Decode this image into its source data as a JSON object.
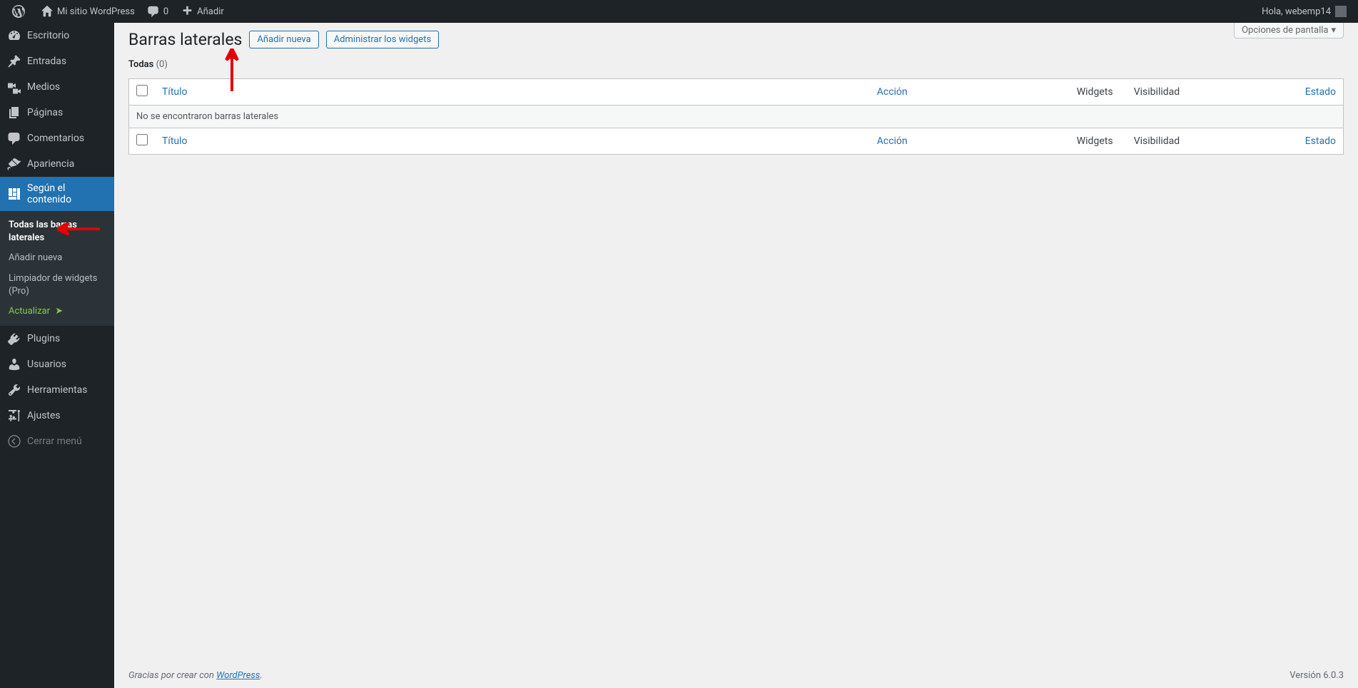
{
  "adminbar": {
    "site_name": "Mi sitio WordPress",
    "comments_count": "0",
    "add_label": "Añadir",
    "greeting": "Hola, webemp14"
  },
  "menu": {
    "items": [
      {
        "id": "dashboard",
        "label": "Escritorio",
        "icon": "dashboard"
      },
      {
        "id": "posts",
        "label": "Entradas",
        "icon": "pin"
      },
      {
        "id": "media",
        "label": "Medios",
        "icon": "media"
      },
      {
        "id": "pages",
        "label": "Páginas",
        "icon": "page"
      },
      {
        "id": "comments",
        "label": "Comentarios",
        "icon": "comment"
      },
      {
        "id": "appearance",
        "label": "Apariencia",
        "icon": "brush"
      },
      {
        "id": "contentaware",
        "label": "Según el contenido",
        "icon": "layout",
        "current": true
      },
      {
        "id": "plugins",
        "label": "Plugins",
        "icon": "plugin"
      },
      {
        "id": "users",
        "label": "Usuarios",
        "icon": "user"
      },
      {
        "id": "tools",
        "label": "Herramientas",
        "icon": "wrench"
      },
      {
        "id": "settings",
        "label": "Ajustes",
        "icon": "sliders"
      },
      {
        "id": "collapse",
        "label": "Cerrar menú",
        "icon": "collapse"
      }
    ],
    "submenu": [
      {
        "label": "Todas las barras laterales",
        "current": true
      },
      {
        "label": "Añadir nueva"
      },
      {
        "label": "Limpiador de widgets (Pro)"
      },
      {
        "label": "Actualizar",
        "update": true
      }
    ]
  },
  "screen_options": "Opciones de pantalla",
  "page": {
    "title": "Barras laterales",
    "add_new": "Añadir nueva",
    "manage_widgets": "Administrar los widgets",
    "filter_all": "Todas",
    "filter_count": "(0)"
  },
  "table": {
    "cols": {
      "title": "Título",
      "action": "Acción",
      "widgets": "Widgets",
      "visibility": "Visibilidad",
      "status": "Estado"
    },
    "empty": "No se encontraron barras laterales"
  },
  "footer": {
    "thanks": "Gracias por crear con ",
    "wp": "WordPress",
    "period": ".",
    "version": "Versión 6.0.3"
  }
}
